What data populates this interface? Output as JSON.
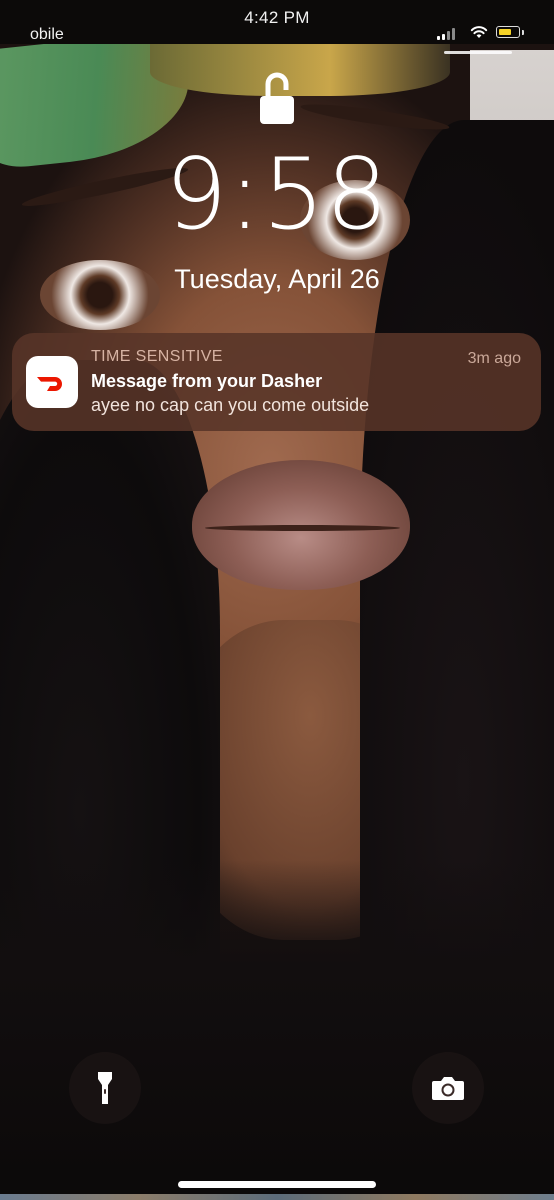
{
  "outer_status_bar": {
    "time": "4:42 PM",
    "carrier_fragment": "obile"
  },
  "lock_screen": {
    "time": "9:58",
    "date": "Tuesday, April 26"
  },
  "notification": {
    "app_icon": "doordash-app-icon",
    "category": "TIME SENSITIVE",
    "age": "3m ago",
    "title": "Message from your Dasher",
    "body": "ayee no cap can you come outside"
  },
  "quick_actions": {
    "left_icon": "flashlight-icon",
    "right_icon": "camera-icon"
  },
  "colors": {
    "notification_bg": "#583428",
    "doordash_red": "#eb1700",
    "battery_fill": "#f5d227"
  }
}
